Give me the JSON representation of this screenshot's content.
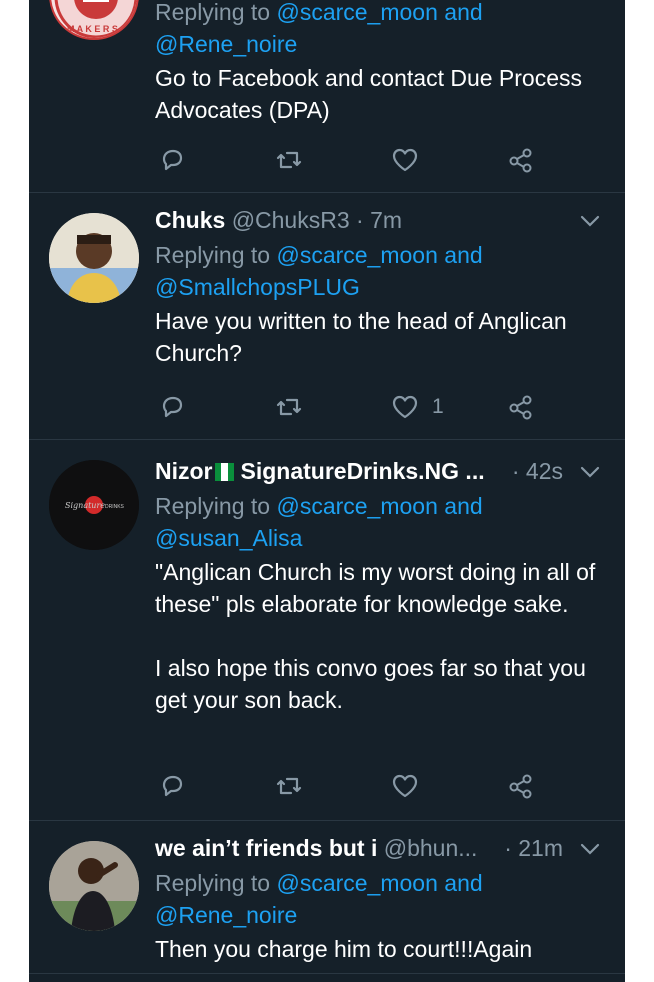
{
  "tweets": [
    {
      "name": "",
      "handle": "",
      "time": "",
      "replying_prefix": "Replying to",
      "replying_to_1": "@scarce_moon and",
      "replying_to_2": "@Rene_noire",
      "text": "Go to Facebook and contact Due Process Advocates (DPA)",
      "like_count": "",
      "avatar": "makers-logo-badge"
    },
    {
      "name": "Chuks",
      "handle": "@ChuksR3",
      "time": "· 7m",
      "replying_prefix": "Replying to",
      "replying_to_1": "@scarce_moon and",
      "replying_to_2": "@SmallchopsPLUG",
      "text": "Have you written to the head of Anglican Church?",
      "like_count": "1",
      "avatar": "man-photo"
    },
    {
      "name": "Nizor",
      "name_suffix": "SignatureDrinks.NG ...",
      "handle": "",
      "time": "· 42s",
      "replying_prefix": "Replying to",
      "replying_to_1": "@scarce_moon and",
      "replying_to_2": "@susan_Alisa",
      "text": "\"Anglican Church is my worst doing in all of these\" pls elaborate for knowledge sake.\n\nI also hope this convo goes far so that you get your son back.",
      "like_count": "",
      "avatar": "signature-drinks-logo"
    },
    {
      "name": "we ain’t friends but i",
      "handle": "@bhun...",
      "time": "· 21m",
      "replying_prefix": "Replying to",
      "replying_to_1": "@scarce_moon and",
      "replying_to_2": "@Rene_noire",
      "text": "Then you charge him to court!!!Again",
      "like_count": "",
      "avatar": "woman-photo"
    }
  ],
  "icons": [
    "reply-icon",
    "retweet-icon",
    "like-icon",
    "share-icon",
    "chevron-down-icon",
    "nigeria-flag-icon"
  ],
  "colors": {
    "background": "#152029",
    "link": "#1da1f2",
    "muted": "#8899a6",
    "text": "#ffffff"
  }
}
